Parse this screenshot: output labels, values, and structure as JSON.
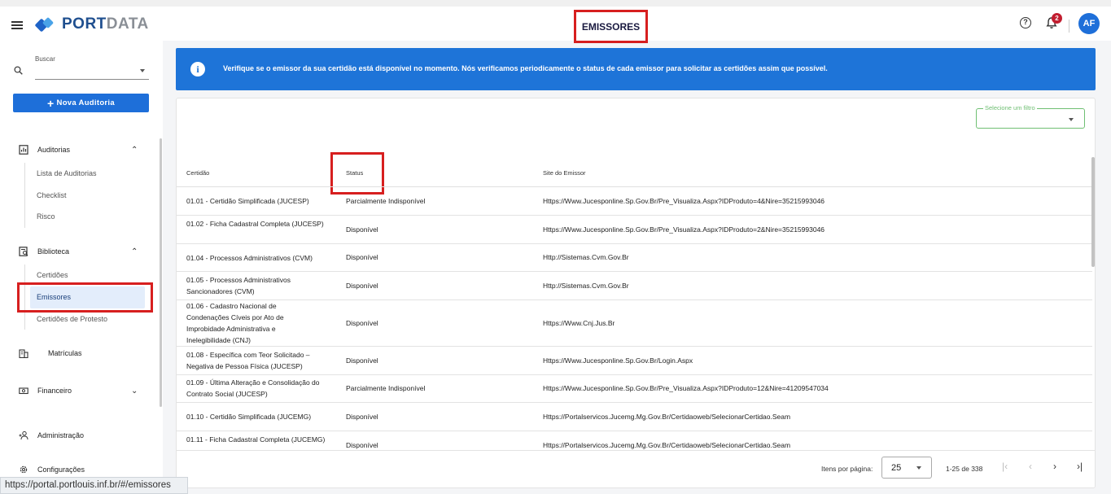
{
  "header": {
    "logo_part1": "PORT",
    "logo_part2": "DATA",
    "title": "EMISSORES",
    "notification_count": "2",
    "avatar_initials": "AF"
  },
  "sidebar": {
    "search_label": "Buscar",
    "new_audit_label": "Nova Auditoria",
    "sections": [
      {
        "label": "Auditorias",
        "expanded": true,
        "items": [
          "Lista de Auditorias",
          "Checklist",
          "Risco"
        ]
      },
      {
        "label": "Biblioteca",
        "expanded": true,
        "items": [
          "Certidões",
          "Emissores",
          "Certidões de Protesto"
        ]
      },
      {
        "label": "Matrículas"
      },
      {
        "label": "Financeiro",
        "expanded": false
      },
      {
        "label": "Administração"
      },
      {
        "label": "Configurações"
      }
    ],
    "active_item": "Emissores"
  },
  "status_bar_url": "https://portal.portlouis.inf.br/#/emissores",
  "info_banner": {
    "text": "Verifique se o emissor da sua certidão está disponível no momento. Nós verificamos periodicamente o status de cada emissor para solicitar as certidões assim que possível."
  },
  "filter": {
    "placeholder": "Selecione um filtro"
  },
  "table": {
    "columns": [
      "Certidão",
      "Status",
      "Site do Emissor"
    ],
    "rows": [
      [
        "01.01 - Certidão Simplificada (JUCESP)",
        "Parcialmente Indisponível",
        "Https://Www.Jucesponline.Sp.Gov.Br/Pre_Visualiza.Aspx?IDProduto=4&Nire=35215993046"
      ],
      [
        "01.02 - Ficha Cadastral Completa (JUCESP)",
        "Disponível",
        "Https://Www.Jucesponline.Sp.Gov.Br/Pre_Visualiza.Aspx?IDProduto=2&Nire=35215993046"
      ],
      [
        "01.04 - Processos Administrativos (CVM)",
        "Disponível",
        "Http://Sistemas.Cvm.Gov.Br"
      ],
      [
        "01.05 - Processos Administrativos Sancionadores (CVM)",
        "Disponível",
        "Http://Sistemas.Cvm.Gov.Br"
      ],
      [
        "01.06 - Cadastro Nacional de Condenações Cíveis por Ato de Improbidade Administrativa e Inelegibilidade (CNJ)",
        "Disponível",
        "Https://Www.Cnj.Jus.Br"
      ],
      [
        "01.08 - Específica com Teor Solicitado – Negativa de Pessoa Física (JUCESP)",
        "Disponível",
        "Https://Www.Jucesponline.Sp.Gov.Br/Login.Aspx"
      ],
      [
        "01.09 - Última Alteração e Consolidação do Contrato Social (JUCESP)",
        "Parcialmente Indisponível",
        "Https://Www.Jucesponline.Sp.Gov.Br/Pre_Visualiza.Aspx?IDProduto=12&Nire=41209547034"
      ],
      [
        "01.10 - Certidão Simplificada (JUCEMG)",
        "Disponível",
        "Https://Portalservicos.Jucemg.Mg.Gov.Br/Certidaoweb/SelecionarCertidao.Seam"
      ],
      [
        "01.11 - Ficha Cadastral Completa (JUCEMG)",
        "Disponível",
        "Https://Portalservicos.Jucemg.Mg.Gov.Br/Certidaoweb/SelecionarCertidao.Seam"
      ]
    ]
  },
  "paginator": {
    "items_per_page_label": "Itens por página:",
    "page_size": "25",
    "range_label": "1-25 de 338"
  },
  "colors": {
    "primary": "#1e6fd9",
    "banner": "#1e74d8",
    "highlight_box": "#d71f1f",
    "filter_border": "#6fbf73",
    "active_bg": "#e3edfb"
  }
}
